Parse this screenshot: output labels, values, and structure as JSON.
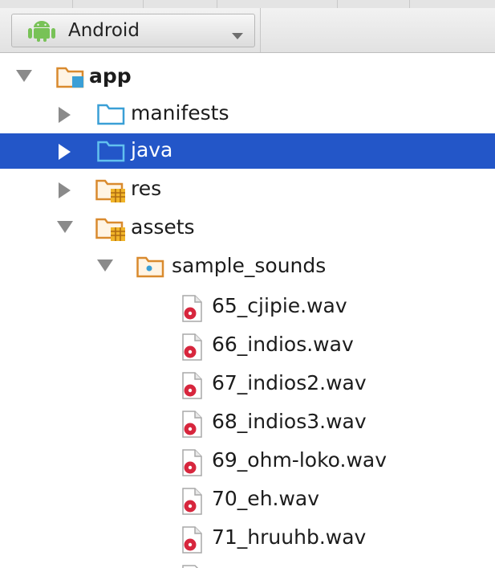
{
  "toolbar": {
    "view_selector": {
      "label": "Android",
      "icon": "android-icon",
      "accent": "#78c257"
    }
  },
  "tree": {
    "app": {
      "label": "app",
      "expanded": true,
      "icon": "module-folder-icon"
    },
    "manifests": {
      "label": "manifests",
      "expanded": false,
      "icon": "folder-icon"
    },
    "java": {
      "label": "java",
      "expanded": false,
      "selected": true,
      "icon": "folder-icon"
    },
    "res": {
      "label": "res",
      "expanded": false,
      "icon": "resource-folder-icon"
    },
    "assets": {
      "label": "assets",
      "expanded": true,
      "icon": "resource-folder-icon"
    },
    "sample_sounds": {
      "label": "sample_sounds",
      "expanded": true,
      "icon": "package-folder-icon"
    },
    "files": [
      {
        "label": "65_cjipie.wav",
        "icon": "audio-file-icon"
      },
      {
        "label": "66_indios.wav",
        "icon": "audio-file-icon"
      },
      {
        "label": "67_indios2.wav",
        "icon": "audio-file-icon"
      },
      {
        "label": "68_indios3.wav",
        "icon": "audio-file-icon"
      },
      {
        "label": "69_ohm-loko.wav",
        "icon": "audio-file-icon"
      },
      {
        "label": "70_eh.wav",
        "icon": "audio-file-icon"
      },
      {
        "label": "71_hruuhb.wav",
        "icon": "audio-file-icon"
      }
    ]
  },
  "colors": {
    "selection": "#2356c8",
    "folder_blue": "#3a9fd6",
    "folder_orange": "#d98a2e",
    "audio_red": "#d7263d"
  }
}
